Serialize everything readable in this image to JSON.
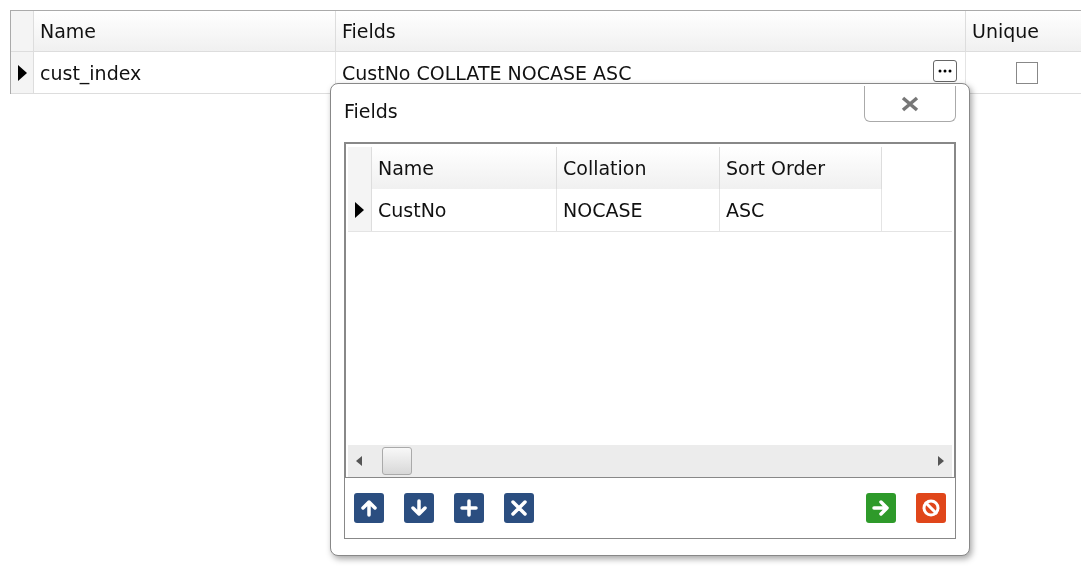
{
  "grid": {
    "columns": [
      "Name",
      "Fields",
      "Unique"
    ],
    "rows": [
      {
        "name": "cust_index",
        "fields": "CustNo COLLATE NOCASE ASC",
        "unique": false,
        "selected": true
      }
    ]
  },
  "popup": {
    "title": "Fields",
    "grid": {
      "columns": [
        "Name",
        "Collation",
        "Sort Order"
      ],
      "rows": [
        {
          "cells": [
            "CustNo",
            "NOCASE",
            "ASC"
          ],
          "selected": true
        }
      ]
    },
    "tools": [
      {
        "kind": "up"
      },
      {
        "kind": "down"
      },
      {
        "kind": "add"
      },
      {
        "kind": "remove"
      }
    ],
    "actions": [
      {
        "kind": "ok"
      },
      {
        "kind": "cancel"
      }
    ]
  }
}
